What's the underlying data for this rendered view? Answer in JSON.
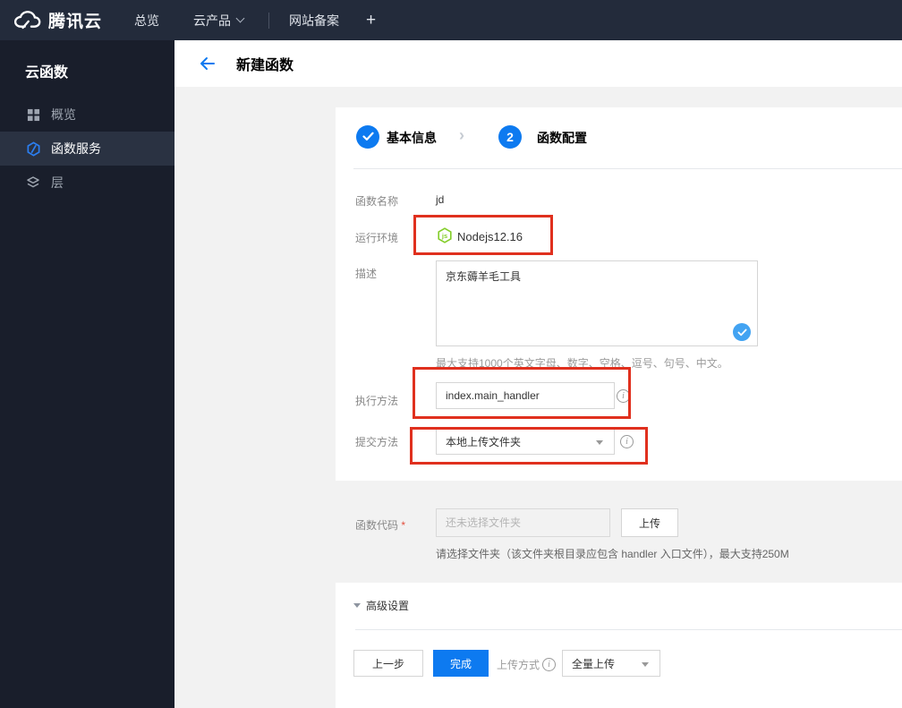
{
  "navbar": {
    "brand": "腾讯云",
    "overview": "总览",
    "products": "云产品",
    "icp": "网站备案",
    "plus": "+"
  },
  "sidebar": {
    "title": "云函数",
    "items": [
      {
        "label": "概览",
        "icon": "grid-icon",
        "active": false
      },
      {
        "label": "函数服务",
        "icon": "scf-hexagon-icon",
        "active": true
      },
      {
        "label": "层",
        "icon": "layers-icon",
        "active": false
      }
    ]
  },
  "header": {
    "title": "新建函数"
  },
  "steps": {
    "step1_label": "基本信息",
    "step2_num": "2",
    "step2_label": "函数配置"
  },
  "form": {
    "name_label": "函数名称",
    "name_value": "jd",
    "runtime_label": "运行环境",
    "runtime_value": "Nodejs12.16",
    "desc_label": "描述",
    "desc_value": "京东薅羊毛工具",
    "desc_hint": "最大支持1000个英文字母、数字、空格、逗号、句号、中文。",
    "handler_label": "执行方法",
    "handler_value": "index.main_handler",
    "submit_label": "提交方法",
    "submit_value": "本地上传文件夹",
    "code_label": "函数代码",
    "code_required": "*",
    "code_placeholder": "还未选择文件夹",
    "upload_button": "上传",
    "code_note": "请选择文件夹（该文件夹根目录应包含 handler 入口文件），最大支持250M",
    "advanced_label": "高级设置"
  },
  "footer": {
    "prev": "上一步",
    "finish": "完成",
    "upload_mode_label": "上传方式",
    "upload_mode_value": "全量上传"
  },
  "colors": {
    "navbar_bg": "#232b3b",
    "sidebar_bg": "#191e2b",
    "sidebar_active_bg": "#2a3242",
    "accent_blue": "#0d7af0",
    "light_check_blue": "#42a3f2",
    "annotation_red": "#e0301e",
    "nodejs_green": "#83cd29",
    "content_bg": "#f2f2f2"
  }
}
